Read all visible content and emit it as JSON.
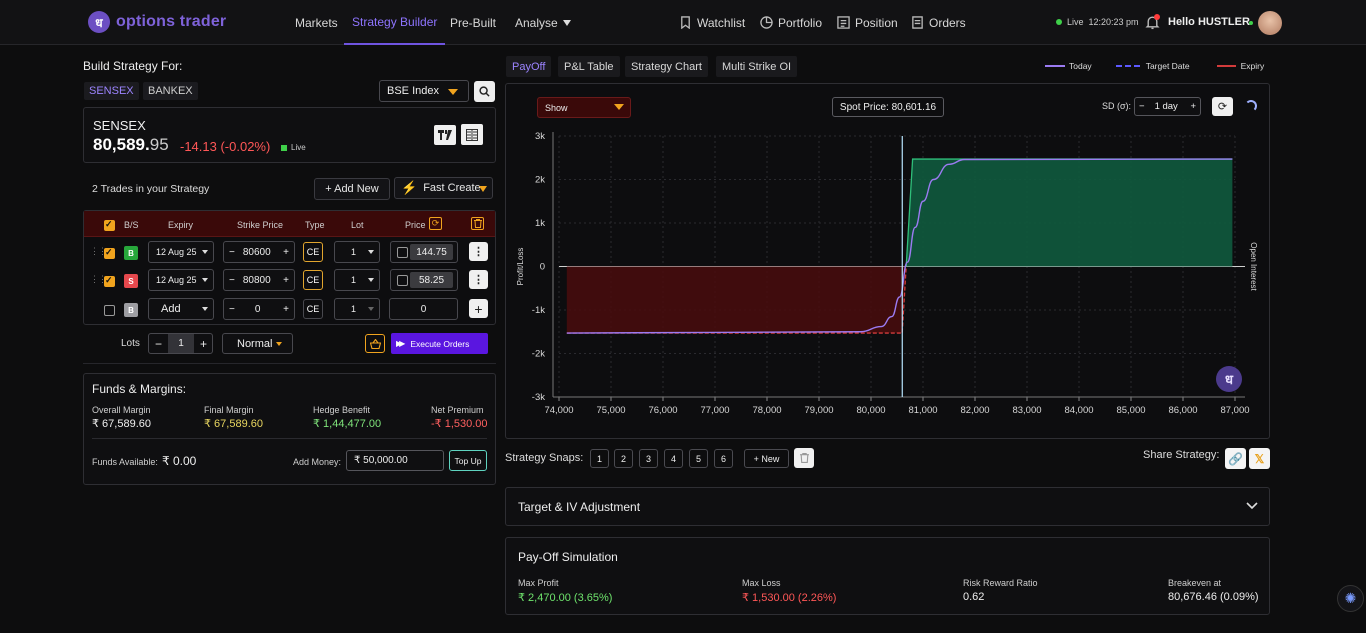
{
  "brand": {
    "name": "options trader",
    "mark": "ध"
  },
  "nav": {
    "markets": "Markets",
    "strategy_builder": "Strategy Builder",
    "pre_built": "Pre-Built",
    "analyse": "Analyse",
    "watchlist": "Watchlist",
    "portfolio": "Portfolio",
    "position": "Position",
    "orders": "Orders"
  },
  "status": {
    "live_label": "Live",
    "time": "12:20:23 pm",
    "greeting": "Hello HUSTLER"
  },
  "build": {
    "title": "Build Strategy For:",
    "index_tabs": [
      "SENSEX",
      "BANKEX"
    ],
    "index_select": "BSE Index",
    "quote": {
      "symbol": "SENSEX",
      "price_main": "80,589.",
      "price_dec": "95",
      "change": "-14.13 (-0.02%)",
      "live": "Live"
    },
    "trades_count": "2 Trades in your Strategy",
    "add_new": "+ Add New",
    "fast_create": "Fast Create",
    "headers": {
      "bs": "B/S",
      "expiry": "Expiry",
      "strike": "Strike Price",
      "type": "Type",
      "lot": "Lot",
      "price": "Price"
    },
    "rows": [
      {
        "bs": "B",
        "expiry": "12 Aug 25",
        "strike": "80600",
        "type": "CE",
        "lot": "1",
        "price": "144.75"
      },
      {
        "bs": "S",
        "expiry": "12 Aug 25",
        "strike": "80800",
        "type": "CE",
        "lot": "1",
        "price": "58.25"
      },
      {
        "bs": "B",
        "expiry": "Add",
        "strike": "0",
        "type": "CE",
        "lot": "1",
        "price": "0"
      }
    ],
    "lots_label": "Lots",
    "lots_value": "1",
    "order_type": "Normal",
    "execute": "Execute Orders"
  },
  "funds": {
    "title": "Funds & Margins:",
    "items": [
      {
        "label": "Overall Margin",
        "value": "₹ 67,589.60"
      },
      {
        "label": "Final Margin",
        "value": "₹ 67,589.60"
      },
      {
        "label": "Hedge Benefit",
        "value": "₹ 1,44,477.00"
      },
      {
        "label": "Net Premium",
        "value": "-₹ 1,530.00"
      }
    ],
    "available_label": "Funds Available:",
    "available_value": "₹ 0.00",
    "add_money_label": "Add Money:",
    "add_money_value": "₹ 50,000.00",
    "top_up": "Top Up"
  },
  "chart_tabs": [
    "PayOff",
    "P&L Table",
    "Strategy Chart",
    "Multi Strike OI"
  ],
  "legend": {
    "today": "Today",
    "target": "Target Date",
    "expiry": "Expiry"
  },
  "chart_controls": {
    "show": "Show",
    "spot": "Spot Price: 80,601.16",
    "sd_label": "SD (σ):",
    "sd_value": "1 day"
  },
  "chart_data": {
    "type": "line",
    "ylabel": "Profit/Loss",
    "y2label": "Open Interest",
    "x_ticks": [
      "74,000",
      "75,000",
      "76,000",
      "77,000",
      "78,000",
      "79,000",
      "80,000",
      "81,000",
      "82,000",
      "83,000",
      "84,000",
      "85,000",
      "86,000",
      "87,000"
    ],
    "y_ticks": [
      "3k",
      "2k",
      "1k",
      "0",
      "-1k",
      "-2k",
      "-3k"
    ],
    "xlim": [
      74000,
      87000
    ],
    "ylim": [
      -3000,
      3000
    ],
    "spot": 80601.16,
    "series": [
      {
        "name": "Expiry",
        "color": "#d23b3b",
        "x": [
          74150,
          80600,
          80800,
          86950
        ],
        "y": [
          -1530,
          -1530,
          2470,
          2470
        ]
      },
      {
        "name": "Today",
        "color": "#9b7bf2",
        "x": [
          74150,
          79800,
          80200,
          80400,
          80550,
          80700,
          80850,
          81000,
          81200,
          81500,
          81800,
          86950
        ],
        "y": [
          -1530,
          -1500,
          -1380,
          -1150,
          -700,
          100,
          900,
          1500,
          2000,
          2350,
          2460,
          2470
        ]
      }
    ]
  },
  "snaps": {
    "label": "Strategy Snaps:",
    "items": [
      "1",
      "2",
      "3",
      "4",
      "5",
      "6"
    ],
    "new": "+ New",
    "share": "Share Strategy:"
  },
  "target_iv": "Target & IV Adjustment",
  "payoff_sim": {
    "title": "Pay-Off Simulation",
    "items": [
      {
        "label": "Max Profit",
        "value": "₹ 2,470.00 (3.65%)"
      },
      {
        "label": "Max Loss",
        "value": "₹ 1,530.00 (2.26%)"
      },
      {
        "label": "Risk Reward Ratio",
        "value": "0.62"
      },
      {
        "label": "Breakeven at",
        "value": "80,676.46 (0.09%)"
      }
    ]
  }
}
